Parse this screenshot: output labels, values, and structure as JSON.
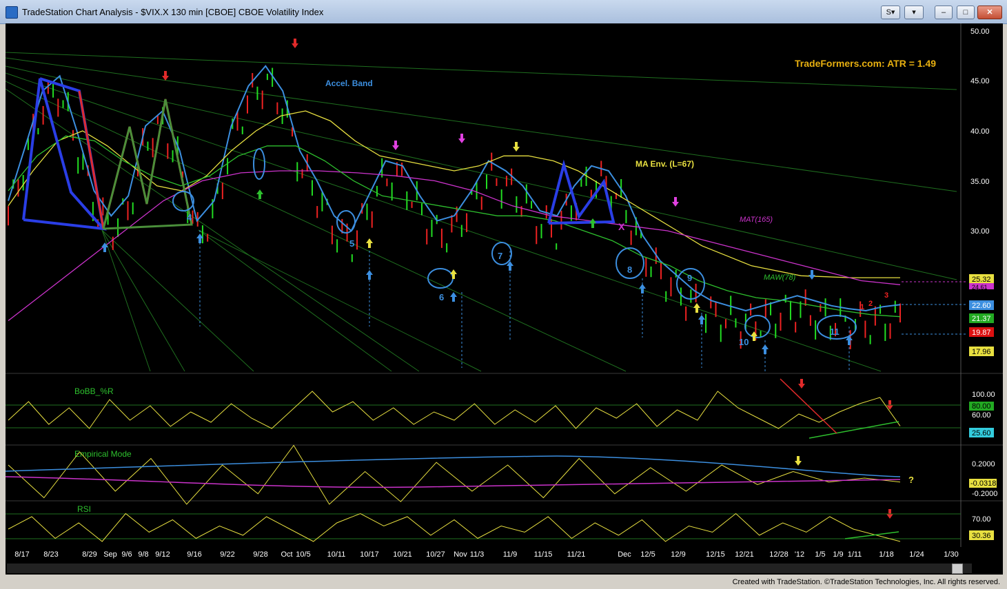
{
  "window": {
    "title": "TradeStation Chart Analysis - $VIX.X 130 min [CBOE] CBOE Volatility Index",
    "footer": "Created with TradeStation. ©TradeStation Technologies, Inc. All rights reserved."
  },
  "colors": {
    "background": "#000000",
    "grid": "#1f6f1f",
    "price_up": "#22dd22",
    "price_down": "#ee2222",
    "accel_band": "#3c8fe0",
    "ma_env": "#e8e040",
    "mat": "#cc33cc",
    "maw": "#2ec02e",
    "pattern_blue": "#2a3ee6",
    "pattern_red": "#e02a2a",
    "pattern_green": "#4a8f3a",
    "annotation_gold": "#e8b010"
  },
  "chart_data": [
    {
      "type": "line",
      "pane": "price",
      "axis_side": "right",
      "ylim": [
        15,
        52
      ],
      "y_ticks": [
        "50.00",
        "45.00",
        "40.00",
        "35.00",
        "30.00"
      ],
      "x_ticks": [
        "8/17",
        "8/23",
        "8/29",
        "Sep",
        "9/6",
        "9/8",
        "9/12",
        "9/16",
        "9/22",
        "9/28",
        "Oct",
        "10/5",
        "10/11",
        "10/17",
        "10/21",
        "10/27",
        "Nov",
        "11/3",
        "11/9",
        "11/15",
        "11/21",
        "Dec",
        "12/5",
        "12/9",
        "12/15",
        "12/21",
        "12/28",
        "'12",
        "1/5",
        "1/9",
        "1/11",
        "1/18",
        "1/24",
        "1/30"
      ],
      "annotations": {
        "atr": "TradeFormers.com: ATR  = 1.49",
        "accel_band": "Accel. Band",
        "ma_env": "MA Env. (L=67)",
        "mat": "MAT(165)",
        "maw": "MAW(78)",
        "wave_labels": [
          "4",
          "5",
          "6",
          "7",
          "8",
          "9",
          "10",
          "11"
        ],
        "red_counts": [
          "1",
          "2",
          "3"
        ],
        "x_mark": "X"
      },
      "value_labels": [
        "25.32",
        "24.61",
        "22.60",
        "21.37",
        "19.87",
        "17.96"
      ],
      "series": [
        {
          "name": "Accel. Band",
          "values": [
            33.0,
            38.5,
            44.0,
            45.5,
            40.0,
            34.0,
            31.5,
            33.5,
            40.5,
            42.0,
            38.0,
            31.0,
            33.0,
            40.5,
            44.5,
            46.5,
            44.0,
            38.0,
            35.0,
            31.5,
            30.0,
            33.5,
            37.0,
            36.5,
            33.5,
            31.0,
            31.5,
            34.0,
            37.0,
            36.0,
            34.5,
            32.0,
            31.5,
            34.5,
            36.5,
            36.0,
            33.5,
            29.5,
            27.0,
            25.5,
            24.0,
            23.0,
            22.5,
            22.0,
            22.5,
            23.0,
            23.5,
            23.0,
            22.5,
            22.2,
            22.0,
            22.4,
            22.6
          ]
        },
        {
          "name": "MA Env. (L=67)",
          "values": [
            32.5,
            36.0,
            39.0,
            40.0,
            38.5,
            36.5,
            34.5,
            34.0,
            35.5,
            38.0,
            40.0,
            41.5,
            42.0,
            41.0,
            39.0,
            37.5,
            37.0,
            36.5,
            36.0,
            36.5,
            37.5,
            37.5,
            37.0,
            36.0,
            34.5,
            33.0,
            31.5,
            30.0,
            28.5,
            27.5,
            26.5,
            26.0,
            25.5,
            25.4,
            25.3,
            25.3,
            25.3
          ]
        },
        {
          "name": "MAT(165)",
          "values": [
            21.0,
            24.0,
            27.0,
            30.0,
            33.0,
            35.0,
            35.8,
            36.0,
            36.0,
            35.8,
            35.5,
            35.0,
            34.0,
            32.5,
            31.5,
            31.0,
            30.5,
            30.0,
            29.0,
            28.0,
            27.0,
            26.0,
            25.0,
            24.6
          ]
        },
        {
          "name": "MAW(78)",
          "values": [
            34.0,
            37.5,
            39.5,
            39.0,
            37.0,
            35.5,
            34.5,
            35.5,
            37.5,
            38.5,
            38.5,
            37.0,
            35.0,
            33.5,
            33.0,
            32.5,
            32.0,
            31.5,
            31.5,
            31.0,
            30.0,
            29.0,
            27.5,
            26.5,
            25.0,
            24.0,
            23.3,
            23.0,
            22.5,
            22.0,
            21.6,
            21.4
          ]
        }
      ]
    },
    {
      "type": "line",
      "pane": "BoBB_%R",
      "title": "BoBB_%R",
      "ylim": [
        0,
        120
      ],
      "y_ticks": [
        "100.00",
        "60.00"
      ],
      "value_labels": [
        "80.00",
        "25.60"
      ],
      "series": [
        {
          "name": "BoBB_%R",
          "values": [
            40,
            85,
            30,
            70,
            20,
            90,
            40,
            75,
            25,
            60,
            35,
            80,
            45,
            20,
            65,
            110,
            60,
            85,
            40,
            70,
            30,
            60,
            40,
            80,
            30,
            65,
            35,
            75,
            20,
            70,
            45,
            80,
            25,
            65,
            40,
            110,
            70,
            45,
            20,
            55,
            35,
            60,
            80,
            95,
            26
          ]
        }
      ]
    },
    {
      "type": "line",
      "pane": "Empirical Mode",
      "title": "Empirical Mode",
      "ylim": [
        -0.3,
        0.3
      ],
      "y_ticks": [
        "0.2000",
        "-0.2000"
      ],
      "value_labels": [
        "-0.0318"
      ],
      "annotations": [
        "?"
      ],
      "series": [
        {
          "name": "Empirical Mode",
          "values": [
            0.1,
            -0.15,
            0.2,
            -0.1,
            0.15,
            -0.2,
            0.1,
            -0.12,
            0.25,
            -0.2,
            0.05,
            -0.18,
            0.12,
            -0.1,
            0.1,
            -0.15,
            0.15,
            -0.12,
            0.08,
            -0.1,
            0.1,
            -0.05,
            0.05,
            -0.03,
            0.0,
            -0.03
          ]
        }
      ]
    },
    {
      "type": "line",
      "pane": "RSI",
      "title": "RSI",
      "ylim": [
        10,
        90
      ],
      "y_ticks": [
        "70.00"
      ],
      "value_labels": [
        "30.36"
      ],
      "series": [
        {
          "name": "RSI",
          "values": [
            50,
            70,
            35,
            60,
            30,
            75,
            45,
            65,
            35,
            55,
            40,
            70,
            50,
            30,
            60,
            75,
            55,
            70,
            40,
            65,
            35,
            55,
            45,
            70,
            35,
            60,
            40,
            65,
            30,
            55,
            45,
            75,
            40,
            60,
            45,
            70,
            50,
            40,
            30
          ]
        }
      ]
    }
  ]
}
